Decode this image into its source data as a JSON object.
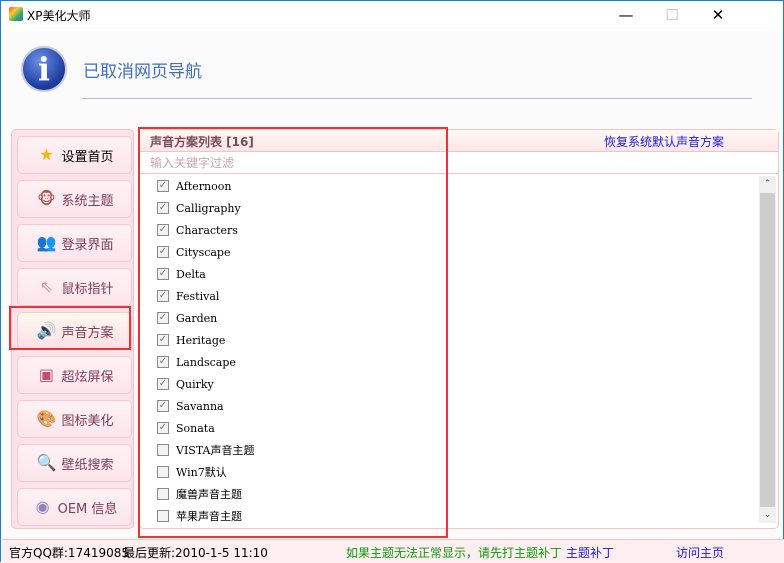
{
  "window": {
    "title": "XP美化大师",
    "minimize": "—",
    "maximize": "☐",
    "close": "✕"
  },
  "header": {
    "icon": "info-icon",
    "message": "已取消网页导航"
  },
  "sidebar": {
    "items": [
      {
        "label": "设置首页",
        "icon": "star-icon",
        "glyph": "★",
        "color": "#f5b800"
      },
      {
        "label": "系统主题",
        "icon": "monkey-icon",
        "glyph": "🐵",
        "color": "#b0504a"
      },
      {
        "label": "登录界面",
        "icon": "users-icon",
        "glyph": "👥",
        "color": "#a06040"
      },
      {
        "label": "鼠标指针",
        "icon": "cursor-icon",
        "glyph": "⇖",
        "color": "#c890a8"
      },
      {
        "label": "声音方案",
        "icon": "speaker-icon",
        "glyph": "🔊",
        "color": "#c070a0",
        "selected": true
      },
      {
        "label": "超炫屏保",
        "icon": "screensaver-icon",
        "glyph": "▣",
        "color": "#c05070"
      },
      {
        "label": "图标美化",
        "icon": "palette-icon",
        "glyph": "🎨",
        "color": "#a07040"
      },
      {
        "label": "壁纸搜索",
        "icon": "magnifier-icon",
        "glyph": "🔍",
        "color": "#c05070"
      },
      {
        "label": "OEM 信息",
        "icon": "globe-icon",
        "glyph": "◉",
        "color": "#9080c0"
      }
    ]
  },
  "main": {
    "list_title": "声音方案列表 [16]",
    "restore_link": "恢复系统默认声音方案",
    "filter_placeholder": "输入关键字过滤",
    "filter_value": "",
    "items": [
      {
        "label": "Afternoon",
        "checked": true
      },
      {
        "label": "Calligraphy",
        "checked": true
      },
      {
        "label": "Characters",
        "checked": true
      },
      {
        "label": "Cityscape",
        "checked": true
      },
      {
        "label": "Delta",
        "checked": true
      },
      {
        "label": "Festival",
        "checked": true
      },
      {
        "label": "Garden",
        "checked": true
      },
      {
        "label": "Heritage",
        "checked": true
      },
      {
        "label": "Landscape",
        "checked": true
      },
      {
        "label": "Quirky",
        "checked": true
      },
      {
        "label": "Savanna",
        "checked": true
      },
      {
        "label": "Sonata",
        "checked": true
      },
      {
        "label": "VISTA声音主题",
        "checked": false
      },
      {
        "label": "Win7默认",
        "checked": false
      },
      {
        "label": "魔兽声音主题",
        "checked": false
      },
      {
        "label": "苹果声音主题",
        "checked": false
      }
    ],
    "scroll_up": "⌃",
    "scroll_down": "⌄"
  },
  "status": {
    "qq": "官方QQ群:17419085",
    "updated": "最后更新:2010-1-5 11:10",
    "notice": "如果主题无法正常显示，请先打主题补丁",
    "patch_link": "主题补丁",
    "home_link": "访问主页"
  },
  "colors": {
    "notice": "#119911",
    "link": "#1a1ae6",
    "highlight": "#ee3333"
  }
}
